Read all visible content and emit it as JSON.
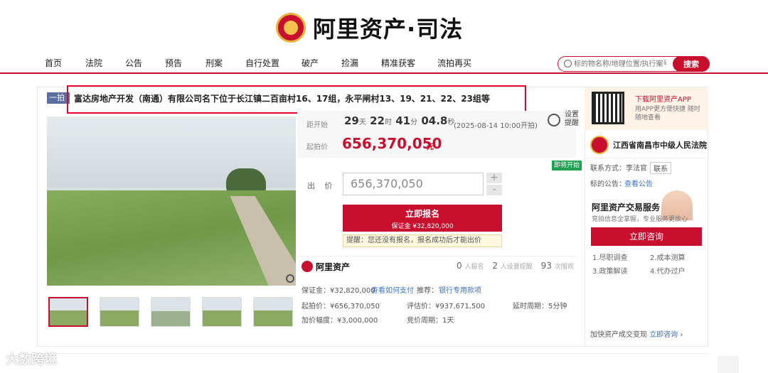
{
  "header": {
    "brand": "阿里资产·司法",
    "search_placeholder": "标的物名称/地理位置/执行案号",
    "search_button": "搜索"
  },
  "nav": [
    "首页",
    "法院",
    "公告",
    "预告",
    "刑案",
    "自行处置",
    "破产",
    "捡漏",
    "精准获客",
    "流拍再买"
  ],
  "listing": {
    "tag": "一拍",
    "title": "富达房地产开发（南通）有限公司名下位于长江镇二百亩村16、17组，永平闸村13、19、21、22、23组等",
    "countdown_label": "距开始",
    "days": "29",
    "days_unit": "天",
    "hours": "22",
    "hours_unit": "时",
    "minutes": "41",
    "minutes_unit": "分",
    "seconds": "04.8",
    "seconds_unit": "秒",
    "start_note": "(2025-08-14 10:00开拍)",
    "remind_text": "设置提醒",
    "start_price_label": "起拍价",
    "start_price": "656,370,050",
    "currency": "元",
    "status_badge": "即将开始",
    "bid_label": "出 价",
    "bid_value": "656,370,050",
    "plus": "+",
    "minus": "-",
    "signup_label": "立即报名",
    "deposit_label": "保证金 ¥32,820,000",
    "tip": "提醒：您还没有报名，报名成功后才能出价"
  },
  "stats": {
    "brand": "阿里资产",
    "signup_count": "0",
    "signup_label": "人报名",
    "reminders_count": "2",
    "reminders_label": "人设置提醒",
    "views_count": "93",
    "views_label": "次围观"
  },
  "details": {
    "deposit": "保证金：¥32,820,000",
    "deposit_link": "查看如何支付",
    "recommend_label": "推荐：",
    "recommend_link": "银行专用款项",
    "start_price": "起拍价：¥656,370,050",
    "appraisal": "评估价：¥937,671,500",
    "extension": "延时周期：5分钟",
    "increment": "加价幅度：¥3,000,000",
    "bid_cycle": "竞价周期：1天"
  },
  "sidebar": {
    "app_title": "下载阿里资产APP",
    "app_desc": "用APP更方便快捷 随时随地查看",
    "court_name": "江西省南昌市中级人民法院",
    "contact": "联系方式：李法官",
    "contact_button": "联系",
    "announcement_label": "标的公告：",
    "announcement_link": "查看公告",
    "ad_title": "阿里资产交易服务",
    "ad_subtitle": "竞拍信息全掌握，专业服务更放心",
    "consult_button": "立即咨询",
    "services": [
      "1.尽职调查",
      "2.成本测算",
      "3.政策解读",
      "4.代办过户"
    ],
    "fast_label": "加快资产成交变现",
    "fast_link": "立即咨询",
    "arrow": "›"
  },
  "watermark": "大数跨境"
}
